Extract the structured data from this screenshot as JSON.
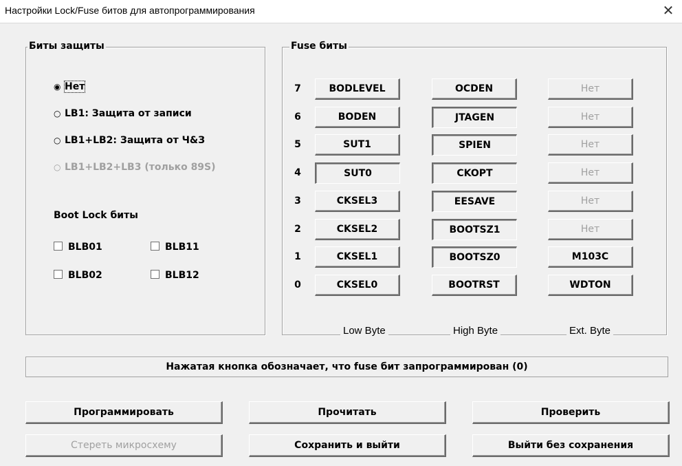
{
  "window": {
    "title": "Настройки Lock/Fuse битов для автопрограммирования",
    "close_glyph": "✕"
  },
  "protection": {
    "legend": "Биты защиты",
    "radios": [
      {
        "label": "Нет",
        "checked": true,
        "enabled": true
      },
      {
        "label": "LB1: Защита от записи",
        "checked": false,
        "enabled": true
      },
      {
        "label": "LB1+LB2: Защита от Ч&З",
        "checked": false,
        "enabled": true
      },
      {
        "label": "LB1+LB2+LB3 (только 89S)",
        "checked": false,
        "enabled": false
      }
    ],
    "boot_lock_title": "Boot Lock биты",
    "checkboxes": [
      {
        "label": "BLB01",
        "checked": false
      },
      {
        "label": "BLB11",
        "checked": false
      },
      {
        "label": "BLB02",
        "checked": false
      },
      {
        "label": "BLB12",
        "checked": false
      }
    ]
  },
  "fuse": {
    "legend": "Fuse биты",
    "bit_numbers": [
      "7",
      "6",
      "5",
      "4",
      "3",
      "2",
      "1",
      "0"
    ],
    "low_byte": [
      {
        "label": "BODLEVEL",
        "pressed": false,
        "enabled": true
      },
      {
        "label": "BODEN",
        "pressed": false,
        "enabled": true
      },
      {
        "label": "SUT1",
        "pressed": false,
        "enabled": true
      },
      {
        "label": "SUT0",
        "pressed": true,
        "enabled": true
      },
      {
        "label": "CKSEL3",
        "pressed": false,
        "enabled": true
      },
      {
        "label": "CKSEL2",
        "pressed": false,
        "enabled": true
      },
      {
        "label": "CKSEL1",
        "pressed": false,
        "enabled": true
      },
      {
        "label": "CKSEL0",
        "pressed": false,
        "enabled": true
      }
    ],
    "high_byte": [
      {
        "label": "OCDEN",
        "pressed": false,
        "enabled": true
      },
      {
        "label": "JTAGEN",
        "pressed": true,
        "enabled": true
      },
      {
        "label": "SPIEN",
        "pressed": true,
        "enabled": true
      },
      {
        "label": "CKOPT",
        "pressed": true,
        "enabled": true
      },
      {
        "label": "EESAVE",
        "pressed": true,
        "enabled": true
      },
      {
        "label": "BOOTSZ1",
        "pressed": true,
        "enabled": true
      },
      {
        "label": "BOOTSZ0",
        "pressed": true,
        "enabled": true
      },
      {
        "label": "BOOTRST",
        "pressed": false,
        "enabled": true
      }
    ],
    "ext_byte": [
      {
        "label": "Нет",
        "pressed": false,
        "enabled": false
      },
      {
        "label": "Нет",
        "pressed": false,
        "enabled": false
      },
      {
        "label": "Нет",
        "pressed": false,
        "enabled": false
      },
      {
        "label": "Нет",
        "pressed": false,
        "enabled": false
      },
      {
        "label": "Нет",
        "pressed": false,
        "enabled": false
      },
      {
        "label": "Нет",
        "pressed": false,
        "enabled": false
      },
      {
        "label": "M103C",
        "pressed": false,
        "enabled": true
      },
      {
        "label": "WDTON",
        "pressed": false,
        "enabled": true
      }
    ],
    "byte_labels": [
      "Low Byte",
      "High Byte",
      "Ext. Byte"
    ]
  },
  "info_text": "Нажатая кнопка обозначает, что fuse бит запрограммирован (0)",
  "buttons": {
    "program": "Программировать",
    "read": "Прочитать",
    "verify": "Проверить",
    "erase": "Стереть микросхему",
    "save_exit": "Сохранить и выйти",
    "exit_no_save": "Выйти без сохранения"
  }
}
